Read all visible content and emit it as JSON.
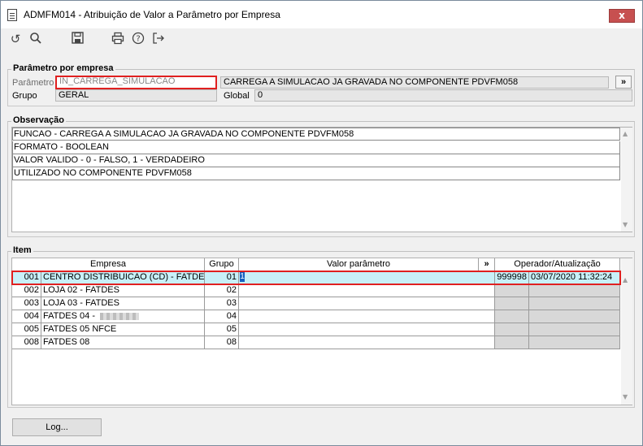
{
  "window": {
    "title": "ADMFM014 - Atribuição de Valor a Parâmetro por Empresa",
    "close_label": "x"
  },
  "toolbar": {
    "icons": [
      "undo-icon",
      "search-icon",
      "save-icon",
      "print-icon",
      "help-icon",
      "exit-icon"
    ],
    "glyphs": [
      "↺",
      "⚲",
      "💾",
      "⎙",
      "?",
      "⇥"
    ]
  },
  "param_group": {
    "legend": "Parâmetro por empresa",
    "parametro_label": "Parâmetro",
    "parametro_value": "IN_CARREGA_SIMULACAO",
    "parametro_desc": "CARREGA A SIMULACAO JA GRAVADA NO COMPONENTE PDVFM058",
    "expand_label": "»",
    "grupo_label": "Grupo",
    "grupo_value": "GERAL",
    "global_label": "Global",
    "global_value": "0"
  },
  "observacao": {
    "legend": "Observação",
    "lines": [
      "FUNCAO - CARREGA A SIMULACAO JA GRAVADA NO COMPONENTE PDVFM058",
      "FORMATO - BOOLEAN",
      "VALOR VALIDO - 0 - FALSO, 1 - VERDADEIRO",
      "UTILIZADO NO COMPONENTE PDVFM058"
    ]
  },
  "item": {
    "legend": "Item",
    "headers": {
      "empresa": "Empresa",
      "grupo": "Grupo",
      "valor": "Valor parâmetro",
      "expand": "»",
      "operador": "Operador/Atualização"
    },
    "rows": [
      {
        "code": "001",
        "name": "CENTRO DISTRIBUICAO (CD) - FATDES",
        "grupo": "01",
        "valor": "1",
        "operador": "999998",
        "data": "03/07/2020 11:32:24"
      },
      {
        "code": "002",
        "name": "LOJA 02 - FATDES",
        "grupo": "02",
        "valor": "",
        "operador": "",
        "data": ""
      },
      {
        "code": "003",
        "name": "LOJA 03 - FATDES",
        "grupo": "03",
        "valor": "",
        "operador": "",
        "data": ""
      },
      {
        "code": "004",
        "name": "FATDES 04 -",
        "grupo": "04",
        "valor": "",
        "operador": "",
        "data": ""
      },
      {
        "code": "005",
        "name": "FATDES 05 NFCE",
        "grupo": "05",
        "valor": "",
        "operador": "",
        "data": ""
      },
      {
        "code": "008",
        "name": "FATDES 08",
        "grupo": "08",
        "valor": "",
        "operador": "",
        "data": ""
      }
    ]
  },
  "footer": {
    "log_label": "Log..."
  },
  "colors": {
    "highlight_border": "#e02020",
    "selected_row": "#c8f0f8",
    "close_button": "#c75050"
  }
}
